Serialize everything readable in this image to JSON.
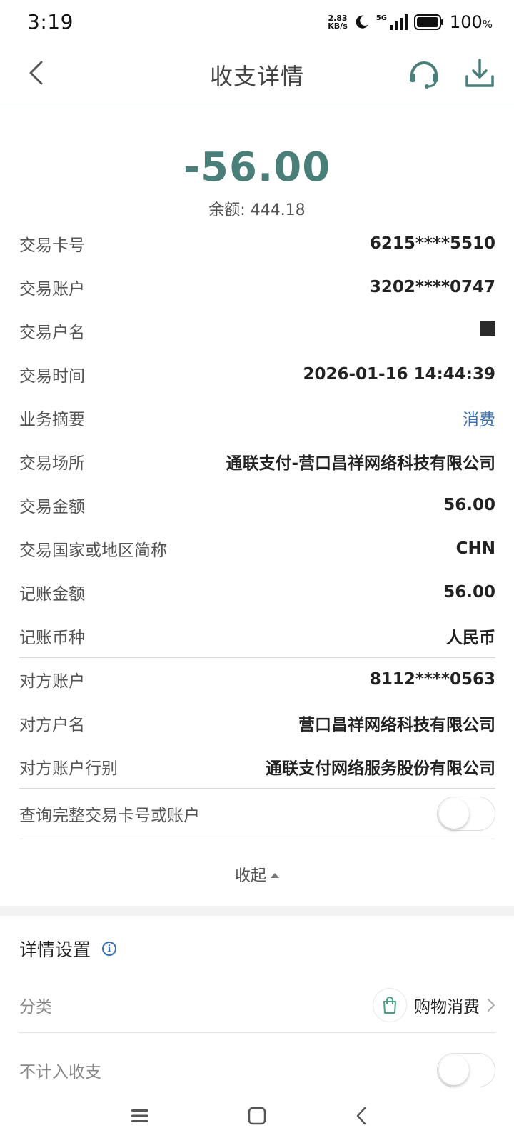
{
  "status_bar": {
    "time": "3:19",
    "net_speed_value": "2.83",
    "net_speed_unit": "KB/s",
    "network": "5G",
    "battery": "100",
    "battery_unit": "%"
  },
  "header": {
    "title": "收支详情",
    "back_icon": "chevron-left-icon",
    "service_icon": "headset-icon",
    "download_icon": "download-icon"
  },
  "summary": {
    "amount": "-56.00",
    "balance": "余额: 444.18"
  },
  "details": [
    {
      "label": "交易卡号",
      "value": "6215****5510"
    },
    {
      "label": "交易账户",
      "value": "3202****0747"
    },
    {
      "label": "交易户名",
      "value": ""
    },
    {
      "label": "交易时间",
      "value": "2026-01-16 14:44:39"
    },
    {
      "label": "业务摘要",
      "value": "消费"
    },
    {
      "label": "交易场所",
      "value": "通联支付-营口昌祥网络科技有限公司"
    },
    {
      "label": "交易金额",
      "value": "56.00"
    },
    {
      "label": "交易国家或地区简称",
      "value": "CHN"
    },
    {
      "label": "记账金额",
      "value": "56.00"
    },
    {
      "label": "记账币种",
      "value": "人民币"
    },
    {
      "label": "对方账户",
      "value": "8112****0563"
    },
    {
      "label": "对方户名",
      "value": "营口昌祥网络科技有限公司"
    },
    {
      "label": "对方账户行别",
      "value": "通联支付网络服务股份有限公司"
    }
  ],
  "full_number_toggle": {
    "label": "查询完整交易卡号或账户",
    "on": false
  },
  "collapse_label": "收起",
  "settings": {
    "title": "详情设置",
    "category_label": "分类",
    "category_value": "购物消费",
    "category_icon": "shopping-bag-icon",
    "exclude_label": "不计入收支",
    "exclude_on": false
  },
  "colors": {
    "accent": "#4a7e78",
    "link": "#3a6fb4"
  }
}
